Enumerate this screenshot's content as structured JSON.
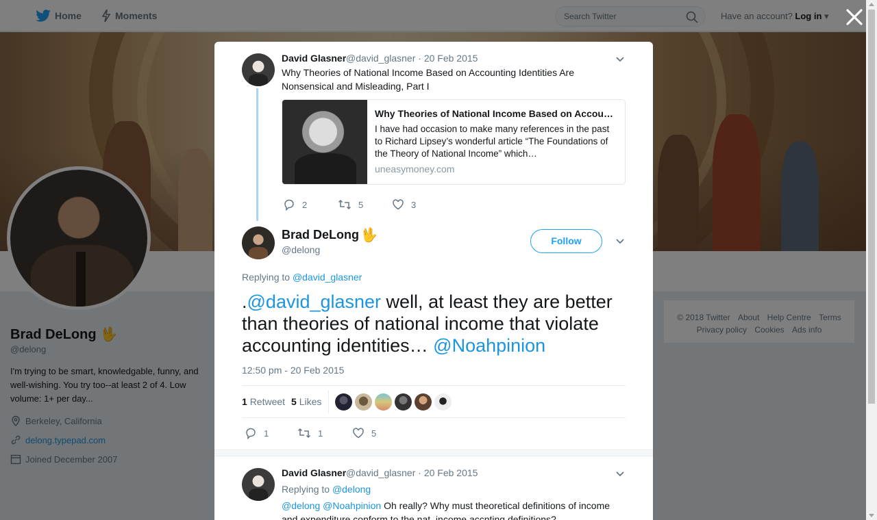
{
  "nav": {
    "home_label": "Home",
    "moments_label": "Moments",
    "search_placeholder": "Search Twitter",
    "have_account": "Have an account?",
    "login_label": "Log in"
  },
  "profile": {
    "name": "Brad DeLong",
    "handle": "@delong",
    "bio": "I'm trying to be smart, knowledgable, funny, and well-wishing. You try too--at least 2 of 4. Low volume: 1+ per day...",
    "location": "Berkeley, California",
    "website": "delong.typepad.com",
    "joined": "Joined December 2007",
    "emoji": "🖖"
  },
  "footer": {
    "copyright": "© 2018 Twitter",
    "about": "About",
    "help": "Help Centre",
    "terms": "Terms",
    "privacy": "Privacy policy",
    "cookies": "Cookies",
    "ads": "Ads info"
  },
  "parent_tweet": {
    "name": "David Glasner",
    "handle": "@david_glasner",
    "date": "· 20 Feb 2015",
    "text": "Why Theories of National Income Based on Accounting Identities Are Nonsensical and Misleading, Part I",
    "card": {
      "title": "Why Theories of National Income Based on Accou…",
      "description": "I have had occasion to make many references in the past to Richard Lipsey’s wonderful article “The Foundations of the Theory of National Income” which…",
      "domain": "uneasymoney.com"
    },
    "replies": "2",
    "retweets": "5",
    "likes": "3"
  },
  "main_tweet": {
    "name": "Brad DeLong",
    "handle": "@delong",
    "emoji": "🖖",
    "follow_label": "Follow",
    "replying_to_label": "Replying to",
    "replying_to": "@david_glasner",
    "text_prefix": ".",
    "mention1": "@david_glasner",
    "text_body": " well, at least they are better than theories of national income that violate accounting identities… ",
    "mention2": "@Noahpinion",
    "timestamp": "12:50 pm - 20 Feb 2015",
    "retweet_count": "1",
    "retweet_label": "Retweet",
    "like_count": "5",
    "like_label": "Likes",
    "replies": "1",
    "retweets": "1",
    "likes": "5"
  },
  "reply_tweet": {
    "name": "David Glasner",
    "handle": "@david_glasner",
    "date": "· 20 Feb 2015",
    "replying_to_label": "Replying to",
    "replying_to": "@delong",
    "mentions": "@delong @Noahpinion",
    "text": " Oh really? Why must theoretical definitions of income and expenditure conform to the nat. income accnting definitions?"
  },
  "colors": {
    "accent": "#1da1f2",
    "link": "#1b95e0",
    "muted": "#657786"
  }
}
